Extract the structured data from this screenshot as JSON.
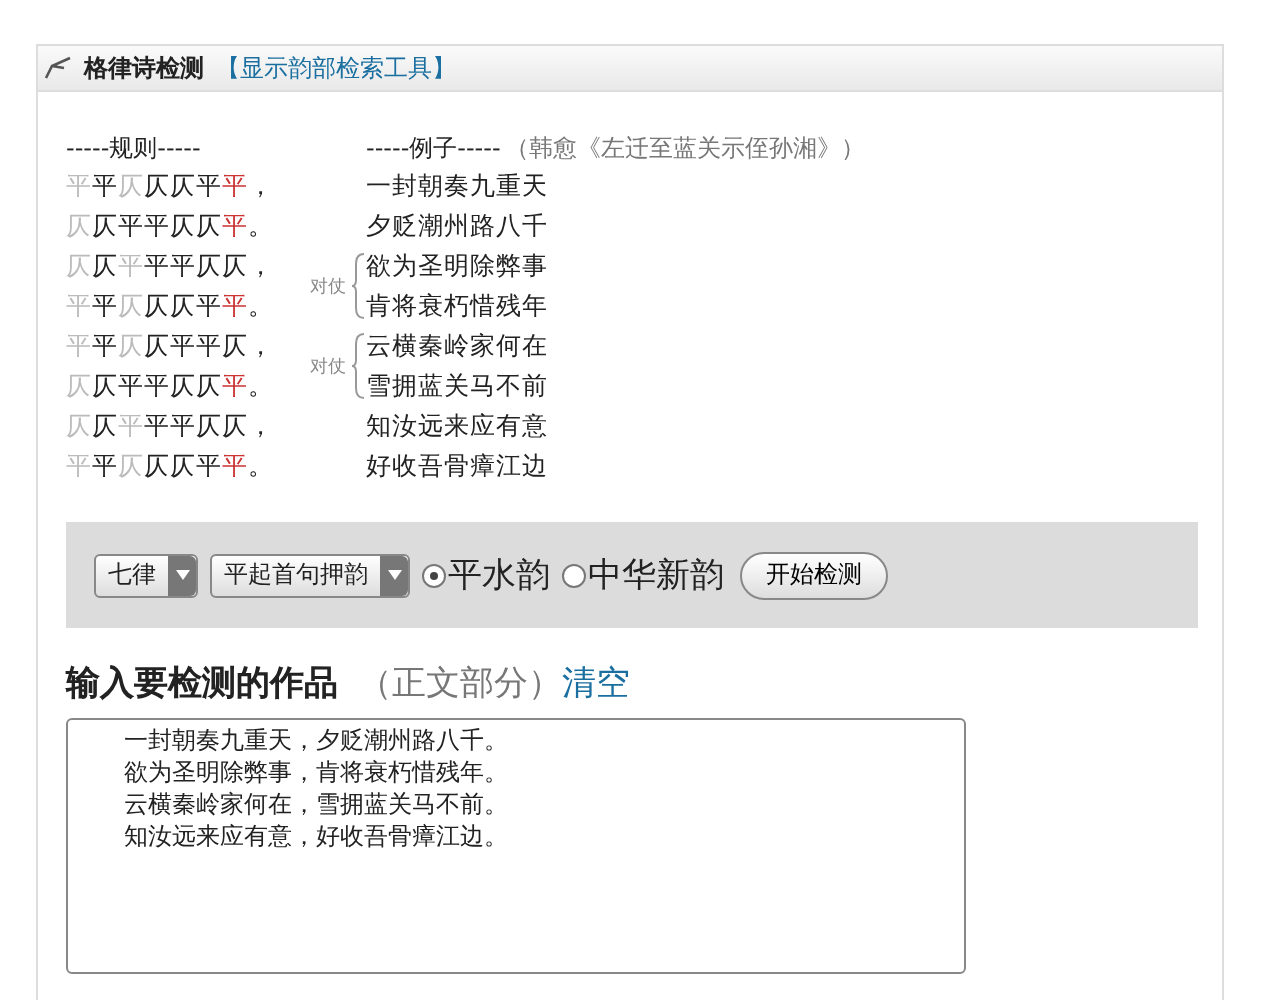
{
  "panel": {
    "title": "格律诗检测",
    "link": "【显示韵部检索工具】"
  },
  "rules_heading": "-----规则-----",
  "examples_heading": "-----例子-----",
  "source": "（韩愈《左迁至蓝关示侄孙湘》）",
  "couplets": [
    {
      "lines": [
        {
          "rule": [
            {
              "c": "平",
              "kind": "free"
            },
            {
              "c": "平",
              "kind": "fixed"
            },
            {
              "c": "仄",
              "kind": "free"
            },
            {
              "c": "仄",
              "kind": "fixed"
            },
            {
              "c": "仄",
              "kind": "fixed"
            },
            {
              "c": "平",
              "kind": "fixed"
            },
            {
              "c": "平",
              "kind": "rhyme"
            },
            {
              "c": "，",
              "kind": "fixed"
            }
          ],
          "example": "一封朝奏九重天"
        },
        {
          "rule": [
            {
              "c": "仄",
              "kind": "free"
            },
            {
              "c": "仄",
              "kind": "fixed"
            },
            {
              "c": "平",
              "kind": "fixed"
            },
            {
              "c": "平",
              "kind": "fixed"
            },
            {
              "c": "仄",
              "kind": "fixed"
            },
            {
              "c": "仄",
              "kind": "fixed"
            },
            {
              "c": "平",
              "kind": "rhyme"
            },
            {
              "c": "。",
              "kind": "fixed"
            }
          ],
          "example": "夕贬潮州路八千"
        }
      ]
    },
    {
      "label": "对仗",
      "lines": [
        {
          "rule": [
            {
              "c": "仄",
              "kind": "free"
            },
            {
              "c": "仄",
              "kind": "fixed"
            },
            {
              "c": "平",
              "kind": "free"
            },
            {
              "c": "平",
              "kind": "fixed"
            },
            {
              "c": "平",
              "kind": "fixed"
            },
            {
              "c": "仄",
              "kind": "fixed"
            },
            {
              "c": "仄",
              "kind": "fixed"
            },
            {
              "c": "，",
              "kind": "fixed"
            }
          ],
          "example": "欲为圣明除弊事"
        },
        {
          "rule": [
            {
              "c": "平",
              "kind": "free"
            },
            {
              "c": "平",
              "kind": "fixed"
            },
            {
              "c": "仄",
              "kind": "free"
            },
            {
              "c": "仄",
              "kind": "fixed"
            },
            {
              "c": "仄",
              "kind": "fixed"
            },
            {
              "c": "平",
              "kind": "fixed"
            },
            {
              "c": "平",
              "kind": "rhyme"
            },
            {
              "c": "。",
              "kind": "fixed"
            }
          ],
          "example": "肯将衰朽惜残年"
        }
      ]
    },
    {
      "label": "对仗",
      "lines": [
        {
          "rule": [
            {
              "c": "平",
              "kind": "free"
            },
            {
              "c": "平",
              "kind": "fixed"
            },
            {
              "c": "仄",
              "kind": "free"
            },
            {
              "c": "仄",
              "kind": "fixed"
            },
            {
              "c": "平",
              "kind": "fixed"
            },
            {
              "c": "平",
              "kind": "fixed"
            },
            {
              "c": "仄",
              "kind": "fixed"
            },
            {
              "c": "，",
              "kind": "fixed"
            }
          ],
          "example": "云横秦岭家何在"
        },
        {
          "rule": [
            {
              "c": "仄",
              "kind": "free"
            },
            {
              "c": "仄",
              "kind": "fixed"
            },
            {
              "c": "平",
              "kind": "fixed"
            },
            {
              "c": "平",
              "kind": "fixed"
            },
            {
              "c": "仄",
              "kind": "fixed"
            },
            {
              "c": "仄",
              "kind": "fixed"
            },
            {
              "c": "平",
              "kind": "rhyme"
            },
            {
              "c": "。",
              "kind": "fixed"
            }
          ],
          "example": "雪拥蓝关马不前"
        }
      ]
    },
    {
      "lines": [
        {
          "rule": [
            {
              "c": "仄",
              "kind": "free"
            },
            {
              "c": "仄",
              "kind": "fixed"
            },
            {
              "c": "平",
              "kind": "free"
            },
            {
              "c": "平",
              "kind": "fixed"
            },
            {
              "c": "平",
              "kind": "fixed"
            },
            {
              "c": "仄",
              "kind": "fixed"
            },
            {
              "c": "仄",
              "kind": "fixed"
            },
            {
              "c": "，",
              "kind": "fixed"
            }
          ],
          "example": "知汝远来应有意"
        },
        {
          "rule": [
            {
              "c": "平",
              "kind": "free"
            },
            {
              "c": "平",
              "kind": "fixed"
            },
            {
              "c": "仄",
              "kind": "free"
            },
            {
              "c": "仄",
              "kind": "fixed"
            },
            {
              "c": "仄",
              "kind": "fixed"
            },
            {
              "c": "平",
              "kind": "fixed"
            },
            {
              "c": "平",
              "kind": "rhyme"
            },
            {
              "c": "。",
              "kind": "fixed"
            }
          ],
          "example": "好收吾骨瘴江边"
        }
      ]
    }
  ],
  "controls": {
    "selects": [
      "七律",
      "平起首句押韵"
    ],
    "radios": [
      {
        "label": "平水韵",
        "selected": true
      },
      {
        "label": "中华新韵",
        "selected": false
      }
    ],
    "button": "开始检测"
  },
  "input": {
    "title": "输入要检测的作品",
    "note": "（正文部分）",
    "clear": "清空",
    "lines": [
      "一封朝奏九重天，夕贬潮州路八千。",
      "欲为圣明除弊事，肯将衰朽惜残年。",
      "云横秦岭家何在，雪拥蓝关马不前。",
      "知汝远来应有意，好收吾骨瘴江边。"
    ]
  }
}
